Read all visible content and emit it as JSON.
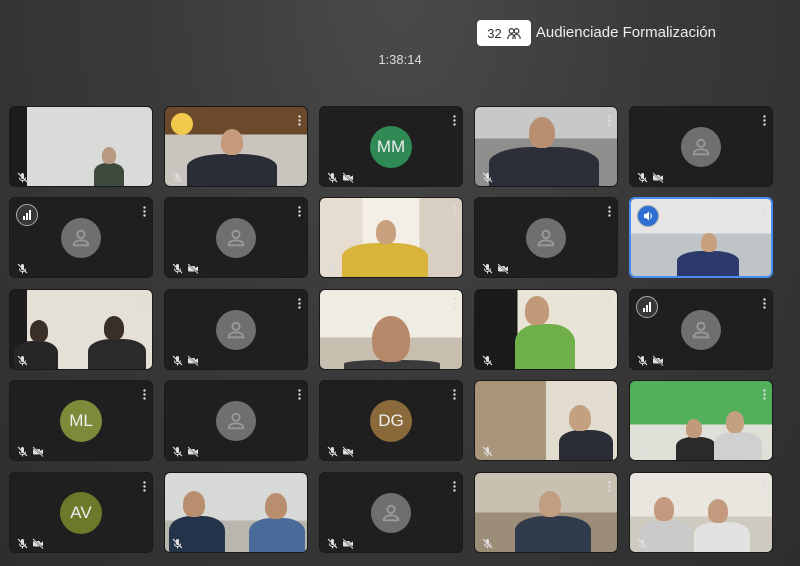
{
  "meeting": {
    "title": "Audienciade Formalización",
    "participant_count": "32",
    "elapsed": "1:38:14"
  },
  "tiles": [
    {
      "row": 0,
      "col": 0,
      "type": "video",
      "muted": true
    },
    {
      "row": 0,
      "col": 1,
      "type": "video",
      "muted": true,
      "badge": "speaking"
    },
    {
      "row": 0,
      "col": 2,
      "type": "initials",
      "initials": "MM",
      "color": "#2f8a55",
      "muted": true,
      "camoff": true
    },
    {
      "row": 0,
      "col": 3,
      "type": "video",
      "muted": true
    },
    {
      "row": 0,
      "col": 4,
      "type": "avatar",
      "muted": true,
      "camoff": true
    },
    {
      "row": 1,
      "col": 0,
      "type": "avatar",
      "muted": true,
      "badge": "bars"
    },
    {
      "row": 1,
      "col": 1,
      "type": "avatar",
      "muted": true,
      "camoff": true
    },
    {
      "row": 1,
      "col": 2,
      "type": "video",
      "muted": true
    },
    {
      "row": 1,
      "col": 3,
      "type": "avatar",
      "muted": true,
      "camoff": true
    },
    {
      "row": 1,
      "col": 4,
      "type": "video",
      "muted": false,
      "active": true,
      "badge": "speaker"
    },
    {
      "row": 2,
      "col": 0,
      "type": "video",
      "muted": true
    },
    {
      "row": 2,
      "col": 1,
      "type": "avatar",
      "muted": true,
      "camoff": true
    },
    {
      "row": 2,
      "col": 2,
      "type": "video",
      "muted": false
    },
    {
      "row": 2,
      "col": 3,
      "type": "video",
      "muted": true
    },
    {
      "row": 2,
      "col": 4,
      "type": "avatar",
      "muted": true,
      "camoff": true,
      "badge": "bars"
    },
    {
      "row": 3,
      "col": 0,
      "type": "initials",
      "initials": "ML",
      "color": "#7d8a3a",
      "muted": true,
      "camoff": true
    },
    {
      "row": 3,
      "col": 1,
      "type": "avatar",
      "muted": true,
      "camoff": true
    },
    {
      "row": 3,
      "col": 2,
      "type": "initials",
      "initials": "DG",
      "color": "#8a6a3a",
      "muted": true,
      "camoff": true
    },
    {
      "row": 3,
      "col": 3,
      "type": "video",
      "muted": true
    },
    {
      "row": 3,
      "col": 4,
      "type": "video",
      "muted": true
    },
    {
      "row": 4,
      "col": 0,
      "type": "initials",
      "initials": "AV",
      "color": "#6b7a2a",
      "muted": true,
      "camoff": true
    },
    {
      "row": 4,
      "col": 1,
      "type": "video",
      "muted": true
    },
    {
      "row": 4,
      "col": 2,
      "type": "avatar",
      "muted": true,
      "camoff": true
    },
    {
      "row": 4,
      "col": 3,
      "type": "video",
      "muted": true
    },
    {
      "row": 4,
      "col": 4,
      "type": "video",
      "muted": true
    }
  ]
}
